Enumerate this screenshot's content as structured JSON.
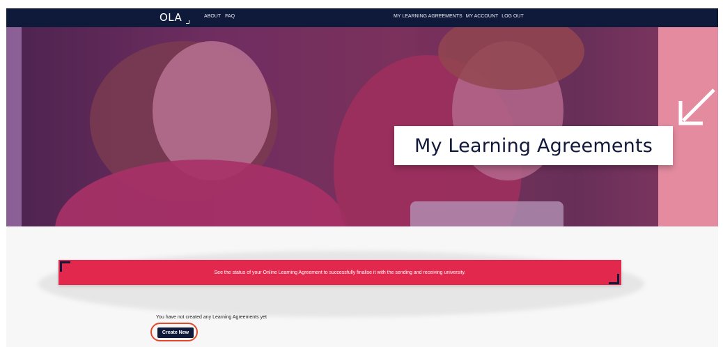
{
  "topbar": {
    "logo_text": "OLA",
    "left_links": [
      "ABOUT",
      "FAQ"
    ],
    "right_links": [
      "MY LEARNING AGREEMENTS",
      "MY ACCOUNT",
      "LOG OUT"
    ]
  },
  "hero": {
    "title": "My Learning Agreements",
    "icon": "arrow-down-left-icon"
  },
  "banner": {
    "text": "See the status of your Online Learning Agreement to successfully finalise it with the sending and receiving university."
  },
  "content": {
    "empty_message": "You have not created any Learning Agreements yet",
    "create_button_label": "Create New"
  },
  "colors": {
    "navy": "#0f1a3a",
    "banner_red": "#e3284e",
    "highlight_ring": "#e1482c",
    "hero_pink_panel": "#e48ba0"
  }
}
